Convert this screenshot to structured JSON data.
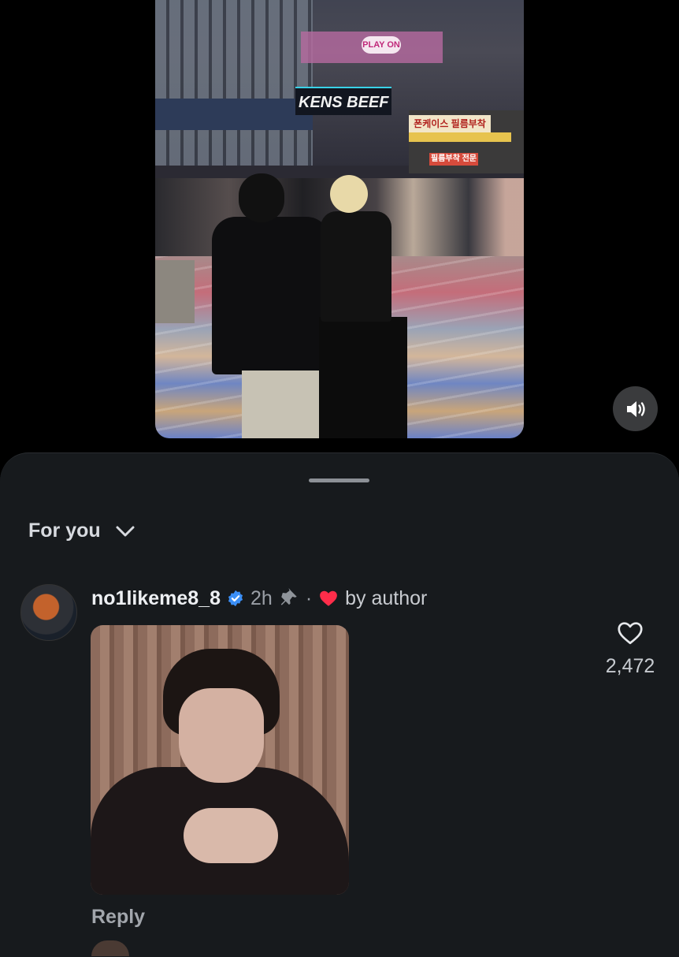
{
  "video": {
    "sign_text_1": "PLAY ON",
    "sign_text_2": "KENS BEEF",
    "sign_text_3": "폰케이스 필름부착",
    "sign_text_4": "필름부착 전문"
  },
  "sound_button": {
    "icon": "speaker-volume-icon"
  },
  "sheet": {
    "sort_label": "For you",
    "sort_icon": "chevron-down-icon"
  },
  "comments": [
    {
      "username": "no1likeme8_8",
      "verified": true,
      "time": "2h",
      "pinned": true,
      "dot": "·",
      "by_author": "by author",
      "reply_label": "Reply",
      "like_count": "2,472"
    }
  ],
  "colors": {
    "sheet_bg": "#171a1d",
    "verified_blue": "#3b8ff6",
    "heart_red": "#ff2d4a"
  }
}
